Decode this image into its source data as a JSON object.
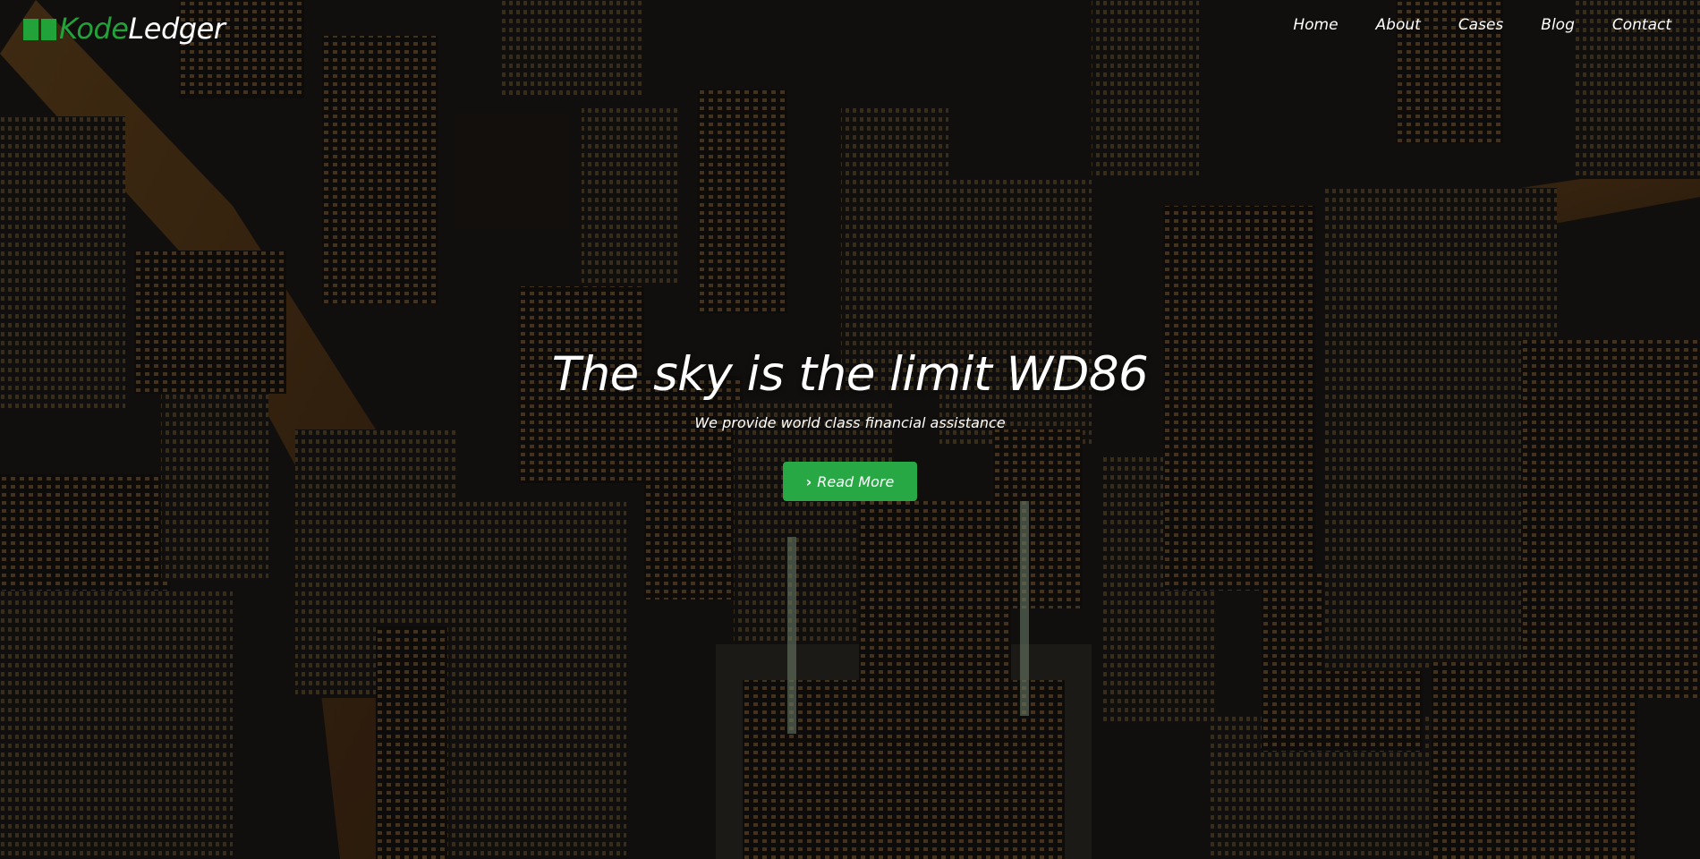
{
  "brand": {
    "part1": "Kode",
    "part2": "Ledger",
    "icon": "book-icon",
    "accent": "#22a33a"
  },
  "nav": {
    "items": [
      {
        "label": "Home"
      },
      {
        "label": "About"
      },
      {
        "label": "Cases"
      },
      {
        "label": "Blog"
      },
      {
        "label": "Contact"
      }
    ]
  },
  "hero": {
    "headline": "The sky is the limit WD86",
    "subline": "We provide world class financial assistance",
    "button_label": "Read More",
    "button_icon": "chevron-right-icon",
    "button_color": "#28a745",
    "background": "aerial-night-city-photo"
  }
}
